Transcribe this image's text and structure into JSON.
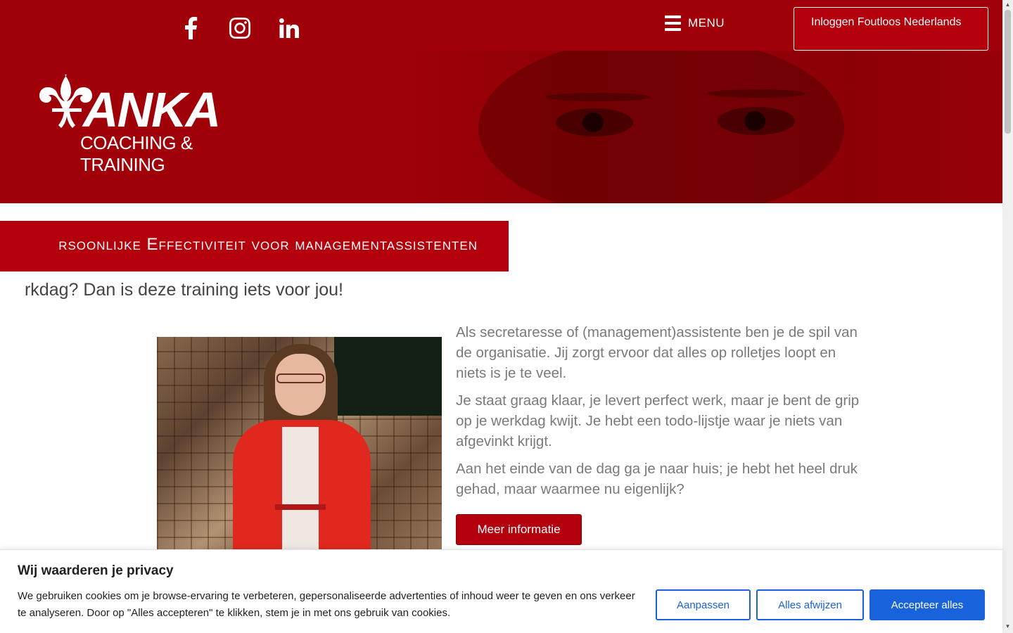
{
  "header": {
    "social": [
      "facebook-icon",
      "instagram-icon",
      "linkedin-icon"
    ],
    "menu_label": "MENU",
    "login_label": "Inloggen Foutloos Nederlands",
    "logo_word": "ANKA",
    "logo_sub": "COACHING & TRAINING"
  },
  "hero": {
    "title": "rsoonlijke Effectiviteit voor managementassistenten",
    "subtitle": "rkdag? Dan is deze training iets voor jou!"
  },
  "content": {
    "paragraphs": [
      "Als secretaresse of (management)assistente ben je de spil van de organisatie. Jij zorgt ervoor dat alles op rolletjes loopt en niets is je te veel.",
      "Je staat graag klaar, je levert perfect werk, maar je bent de grip op je werkdag kwijt. Je hebt een todo-lijstje waar je niets van afgevinkt krijgt.",
      "Aan het einde van de dag ga je naar huis; je hebt het heel druk gehad, maar waarmee nu eigenlijk?"
    ],
    "cta_label": "Meer informatie"
  },
  "cookie": {
    "title": "Wij waarderen je privacy",
    "text": "We gebruiken cookies om je browse-ervaring te verbeteren, gepersonaliseerde advertenties of inhoud weer te geven en ons verkeer te analyseren. Door op \"Alles accepteren\" te klikken, stem je in met ons gebruik van cookies.",
    "customize_label": "Aanpassen",
    "reject_label": "Alles afwijzen",
    "accept_label": "Accepteer alles"
  },
  "colors": {
    "brand_red": "#a00008",
    "button_red": "#b3000c",
    "cookie_blue": "#1863dc"
  }
}
